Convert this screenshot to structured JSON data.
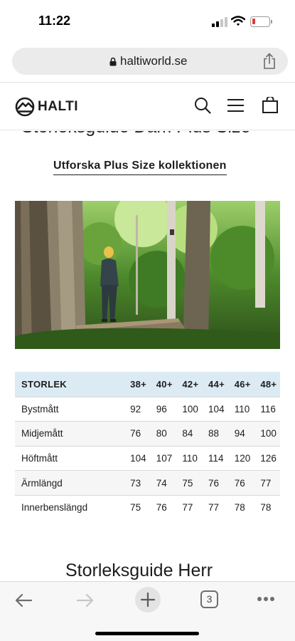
{
  "status_bar": {
    "time": "11:22"
  },
  "browser": {
    "url": "haltiworld.se",
    "tab_count": "3"
  },
  "site": {
    "logo_text": "HALTI"
  },
  "page": {
    "cut_title": "Storleksguide Dam Plus Size",
    "explore_link": "Utforska Plus Size kollektionen",
    "next_heading": "Storleksguide Herr"
  },
  "size_table": {
    "header": [
      "STORLEK",
      "38+",
      "40+",
      "42+",
      "44+",
      "46+",
      "48+"
    ],
    "rows": [
      [
        "Bystmått",
        "92",
        "96",
        "100",
        "104",
        "110",
        "116"
      ],
      [
        "Midjemått",
        "76",
        "80",
        "84",
        "88",
        "94",
        "100"
      ],
      [
        "Höftmått",
        "104",
        "107",
        "110",
        "114",
        "120",
        "126"
      ],
      [
        "Ärmlängd",
        "73",
        "74",
        "75",
        "76",
        "76",
        "77"
      ],
      [
        "Innerbenslängd",
        "75",
        "76",
        "77",
        "77",
        "78",
        "78"
      ]
    ]
  },
  "colors": {
    "table_header_bg": "#dcebf3",
    "text": "#1d1d1d"
  }
}
